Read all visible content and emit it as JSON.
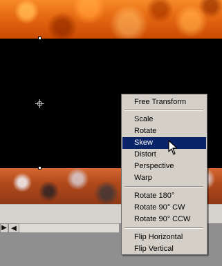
{
  "context_menu": {
    "items": [
      {
        "label": "Free Transform",
        "selected": false
      },
      {
        "label": "Scale",
        "selected": false
      },
      {
        "label": "Rotate",
        "selected": false
      },
      {
        "label": "Skew",
        "selected": true
      },
      {
        "label": "Distort",
        "selected": false
      },
      {
        "label": "Perspective",
        "selected": false
      },
      {
        "label": "Warp",
        "selected": false
      },
      {
        "label": "Rotate 180°",
        "selected": false
      },
      {
        "label": "Rotate 90° CW",
        "selected": false
      },
      {
        "label": "Rotate 90° CCW",
        "selected": false
      },
      {
        "label": "Flip Horizontal",
        "selected": false
      },
      {
        "label": "Flip Vertical",
        "selected": false
      }
    ],
    "selected_color": "#0a246a"
  }
}
